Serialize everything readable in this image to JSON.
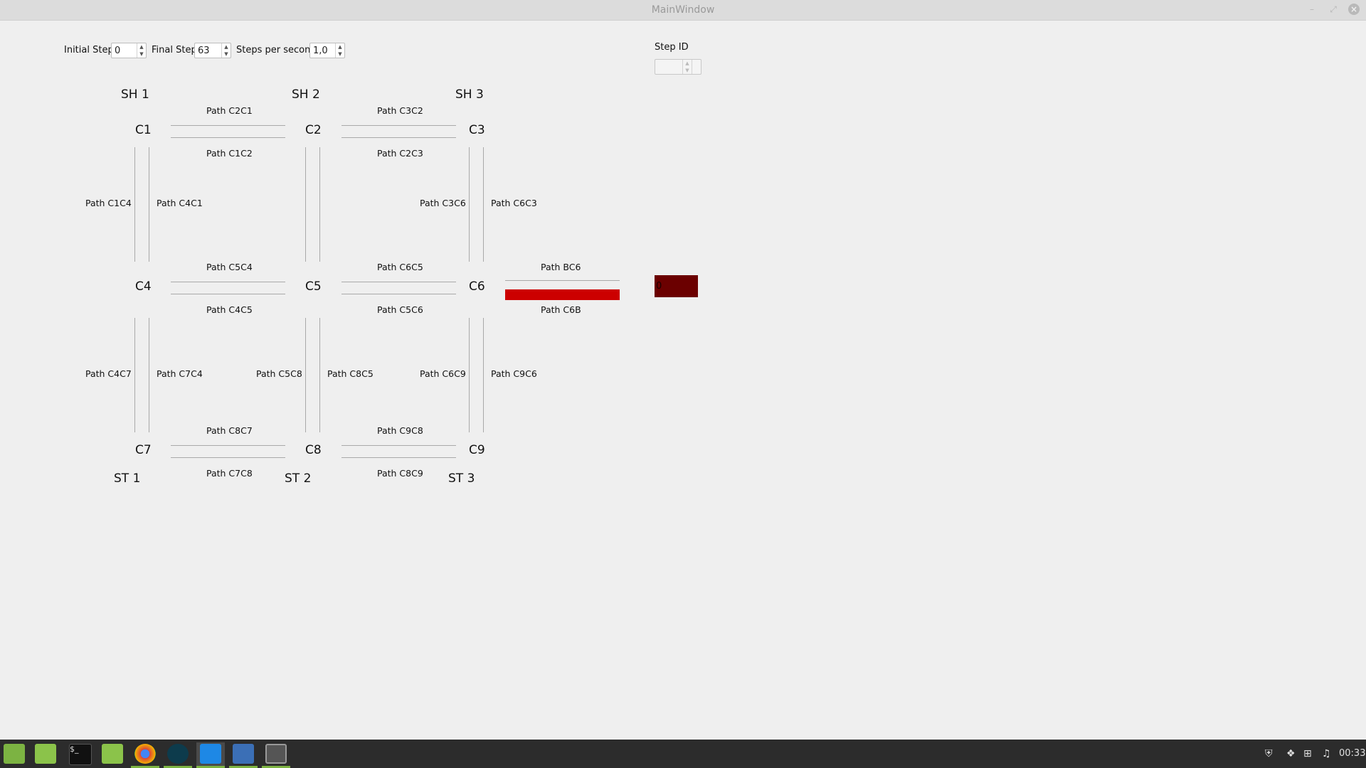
{
  "window": {
    "title": "MainWindow",
    "buttons": {
      "minimize": "–",
      "maximize": "⤢",
      "close": "×"
    }
  },
  "controls": {
    "initial_step": {
      "label": "Initial Step",
      "value": "0"
    },
    "final_step": {
      "label": "Final Step",
      "value": "63"
    },
    "steps_per_second": {
      "label": "Steps per second",
      "value": "1,0"
    },
    "step_id": {
      "label": "Step ID",
      "value": ""
    }
  },
  "grid": {
    "headers": {
      "sh1": "SH 1",
      "sh2": "SH 2",
      "sh3": "SH 3",
      "st1": "ST 1",
      "st2": "ST 2",
      "st3": "ST 3"
    },
    "nodes": {
      "c1": "C1",
      "c2": "C2",
      "c3": "C3",
      "c4": "C4",
      "c5": "C5",
      "c6": "C6",
      "c7": "C7",
      "c8": "C8",
      "c9": "C9"
    },
    "paths": {
      "c2c1": "Path C2C1",
      "c1c2": "Path C1C2",
      "c3c2": "Path C3C2",
      "c2c3": "Path C2C3",
      "c1c4": "Path C1C4",
      "c4c1": "Path C4C1",
      "c3c6": "Path C3C6",
      "c6c3": "Path C6C3",
      "c5c4": "Path C5C4",
      "c4c5": "Path C4C5",
      "c6c5": "Path C6C5",
      "c5c6": "Path C5C6",
      "bc6": "Path BC6",
      "c6b": "Path C6B",
      "c4c7": "Path C4C7",
      "c7c4": "Path C7C4",
      "c5c8": "Path C5C8",
      "c8c5": "Path C8C5",
      "c6c9": "Path C6C9",
      "c9c6": "Path C9C6",
      "c8c7": "Path C8C7",
      "c7c8": "Path C7C8",
      "c9c8": "Path C9C8",
      "c8c9": "Path C8C9"
    },
    "indicator": {
      "value": "0",
      "color": "#6b0000"
    },
    "active_path_color": "#cc0000"
  },
  "taskbar": {
    "clock": "00:33",
    "apps": [
      "mint-menu-icon",
      "desktop-icon",
      "terminal-icon",
      "files-icon",
      "chrome-icon",
      "app-icon",
      "vscode-icon",
      "screenshot-icon",
      "window-icon"
    ],
    "tray": [
      "shield-icon",
      "dropbox-icon",
      "network-icon",
      "volume-icon"
    ]
  }
}
